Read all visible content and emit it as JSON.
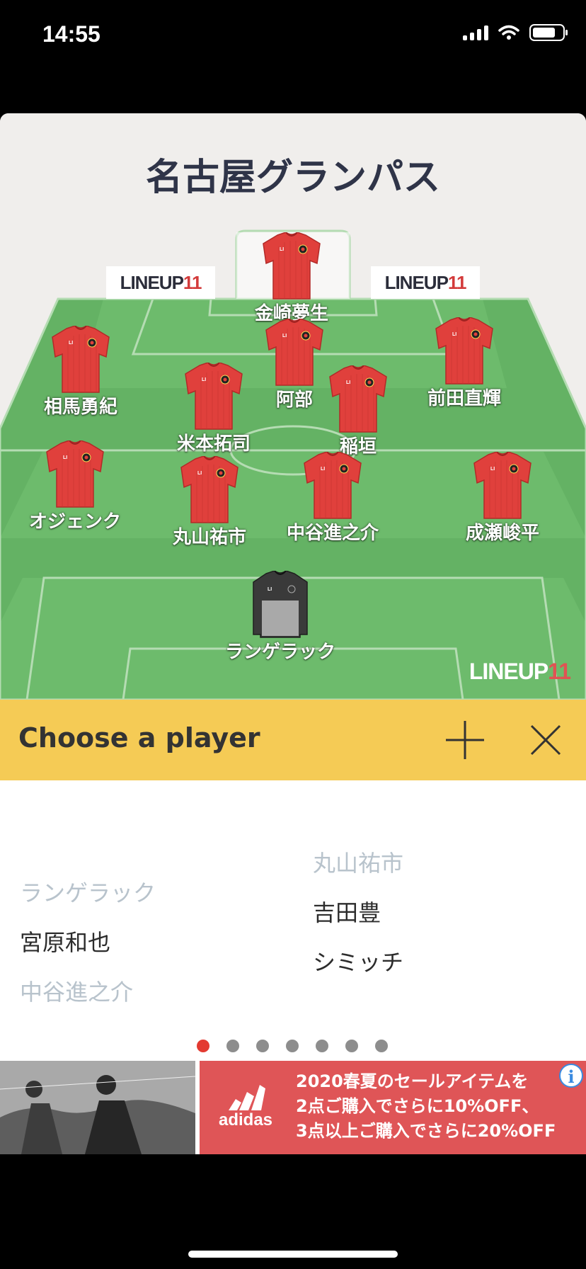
{
  "status_bar": {
    "time": "14:55"
  },
  "team": {
    "name": "名古屋グランパス"
  },
  "brand": {
    "name": "LINEUP",
    "number": "11",
    "jersey_mark": "LI"
  },
  "players": [
    {
      "id": "p1",
      "name": "金崎夢生",
      "kit": "red"
    },
    {
      "id": "p2",
      "name": "相馬勇紀",
      "kit": "red"
    },
    {
      "id": "p3",
      "name": "阿部",
      "kit": "red"
    },
    {
      "id": "p4",
      "name": "前田直輝",
      "kit": "red"
    },
    {
      "id": "p5",
      "name": "米本拓司",
      "kit": "red"
    },
    {
      "id": "p6",
      "name": "稲垣",
      "kit": "red"
    },
    {
      "id": "p7",
      "name": "オジェンク",
      "kit": "red"
    },
    {
      "id": "p8",
      "name": "丸山祐市",
      "kit": "red"
    },
    {
      "id": "p9",
      "name": "中谷進之介",
      "kit": "red"
    },
    {
      "id": "p10",
      "name": "成瀬峻平",
      "kit": "red"
    },
    {
      "id": "p11",
      "name": "ランゲラック",
      "kit": "goalkeeper"
    }
  ],
  "choose_bar": {
    "title": "Choose a player"
  },
  "player_list": {
    "left": [
      {
        "name": "ランゲラック",
        "available": false
      },
      {
        "name": "宮原和也",
        "available": true
      },
      {
        "name": "中谷進之介",
        "available": false
      }
    ],
    "right": [
      {
        "name": "丸山祐市",
        "available": false
      },
      {
        "name": "吉田豊",
        "available": true
      },
      {
        "name": "シミッチ",
        "available": true
      }
    ]
  },
  "pagination": {
    "pages": 7,
    "active": 1
  },
  "ad": {
    "brand": "adidas",
    "lines": [
      "2020春夏のセールアイテムを",
      "2点ご購入でさらに10%OFF、",
      "3点以上ご購入でさらに20%OFF"
    ]
  },
  "colors": {
    "pitch": "#64b264",
    "kit_red": "#e0403c",
    "kit_gk": "#3a3a3a",
    "choose_bar": "#f5cb55",
    "dot_active": "#e33a31",
    "ad_red": "#df5557"
  }
}
